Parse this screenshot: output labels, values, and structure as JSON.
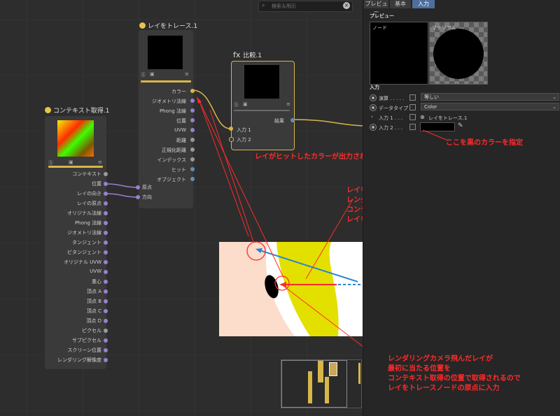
{
  "search": {
    "placeholder": "検索＆明示"
  },
  "tabs": [
    {
      "label": "プレビュー",
      "active": false
    },
    {
      "label": "基本",
      "active": false
    },
    {
      "label": "入力",
      "active": true
    }
  ],
  "panel": {
    "preview_heading": "プレビュー",
    "node_label": "ノード",
    "material_label": "マテリアル",
    "input_heading": "入力",
    "rows": [
      {
        "label": "演算 . . . . .",
        "value": "等しい"
      },
      {
        "label": "データタイプ",
        "value": "Color"
      },
      {
        "label": "入力 1 . . .",
        "value": "レイをトレース.1"
      },
      {
        "label": "入力 2 . . .",
        "value": ""
      }
    ]
  },
  "nodes": {
    "context": {
      "title": "コンテキスト取得.1",
      "outputs": [
        "コンテキスト",
        "位置",
        "レイの向き",
        "レイの原点",
        "オリジナル法線",
        "Phong 法線",
        "ジオメトリ法線",
        "タンジェント",
        "ビタンジェント",
        "オリジナル UVW",
        "UVW",
        "重心",
        "頂点 A",
        "頂点 B",
        "頂点 C",
        "頂点 D",
        "ピクセル",
        "サブピクセル",
        "スクリーン位置",
        "レンダリング解像度"
      ]
    },
    "raytrace": {
      "title": "レイをトレース.1",
      "outputs": [
        "カラー",
        "ジオメトリ法線",
        "Phong 法線",
        "位置",
        "UVW",
        "距離",
        "正規化距離",
        "インデックス",
        "ヒット",
        "オブジェクト"
      ],
      "inputs": [
        "原点",
        "方向"
      ]
    },
    "compare": {
      "title": "比較.1",
      "title_prefix": "fx",
      "output": "結果",
      "inputs": [
        "入力 1",
        "入力 2"
      ]
    }
  },
  "annotations": {
    "specify": "ここを黒のカラーを指定",
    "hit_color": "レイがヒットしたカラーが出力される",
    "direction": [
      "レイをトレースでトレースする方向は",
      "レンダリングのレイと同じにしたいので、",
      "コンテキスト取得のレイの向きを",
      "レイをトレースノードの方向に入力"
    ],
    "origin": [
      "レンダリングカメラ飛んだレイが",
      "最初に当たる位置を",
      "コンテキスト取得の位置で取得されるので",
      "レイをトレースノードの原点に入力"
    ]
  },
  "colors": {
    "annotation": "#ff2b2b",
    "accent": "#d8b648",
    "tab_active": "#4d6f9e",
    "camera": "#1565ff",
    "ray": "#2a85d0"
  }
}
